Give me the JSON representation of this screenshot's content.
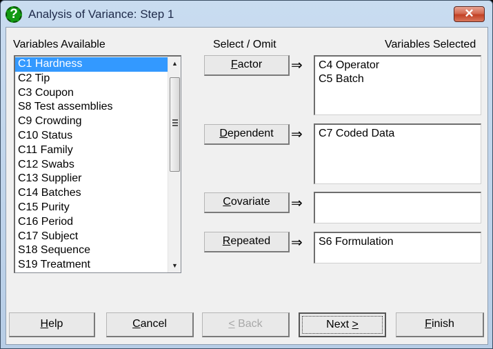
{
  "window": {
    "title": "Analysis of Variance: Step 1",
    "icon": "help-question-icon",
    "close_glyph": "✕"
  },
  "labels": {
    "available": "Variables Available",
    "select_omit": "Select / Omit",
    "selected": "Variables Selected"
  },
  "available_list": {
    "selected_index": 0,
    "items": [
      "C1 Hardness",
      "C2 Tip",
      "C3 Coupon",
      "S8 Test assemblies",
      "C9 Crowding",
      "C10 Status",
      "C11 Family",
      "C12 Swabs",
      "C13 Supplier",
      "C14 Batches",
      "C15 Purity",
      "C16 Period",
      "C17 Subject",
      "S18 Sequence",
      "S19 Treatment"
    ]
  },
  "role_arrow": "⇒",
  "roles": [
    {
      "key": "F",
      "rest": "actor",
      "items": [
        "C4 Operator",
        "C5 Batch"
      ]
    },
    {
      "key": "D",
      "rest": "ependent",
      "items": [
        "C7 Coded Data"
      ]
    },
    {
      "key": "C",
      "rest": "ovariate",
      "items": []
    },
    {
      "key": "R",
      "rest": "epeated",
      "items": [
        "S6 Formulation"
      ]
    }
  ],
  "footer": {
    "help": {
      "key": "H",
      "rest": "elp"
    },
    "cancel": {
      "key": "C",
      "rest": "ancel"
    },
    "back": {
      "key": "<",
      "rest": " Back",
      "disabled": true
    },
    "next": {
      "pre": "Next ",
      "key": ">"
    },
    "finish": {
      "key": "F",
      "rest": "inish"
    }
  }
}
